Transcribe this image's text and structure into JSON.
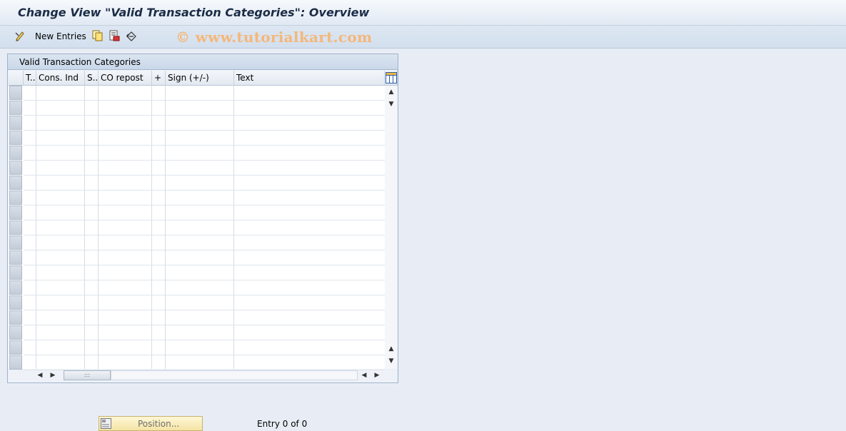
{
  "window": {
    "title": "Change View \"Valid Transaction Categories\": Overview"
  },
  "toolbar": {
    "new_entries_label": "New Entries",
    "icons": [
      "display-change-icon",
      "copy-icon",
      "delete-icon",
      "undo-icon"
    ]
  },
  "watermark": "© www.tutorialkart.com",
  "table": {
    "title": "Valid Transaction Categories",
    "columns": [
      "T..",
      "Cons. Ind",
      "S..",
      "CO repost",
      "+",
      "Sign (+/-)",
      "Text"
    ],
    "rows": []
  },
  "footer": {
    "position_label": "Position...",
    "entry_text": "Entry 0 of 0"
  },
  "colors": {
    "background": "#e8edf5",
    "title_text": "#1b2c46",
    "watermark": "#f4b77a",
    "position_button": "#f4e4a4"
  }
}
